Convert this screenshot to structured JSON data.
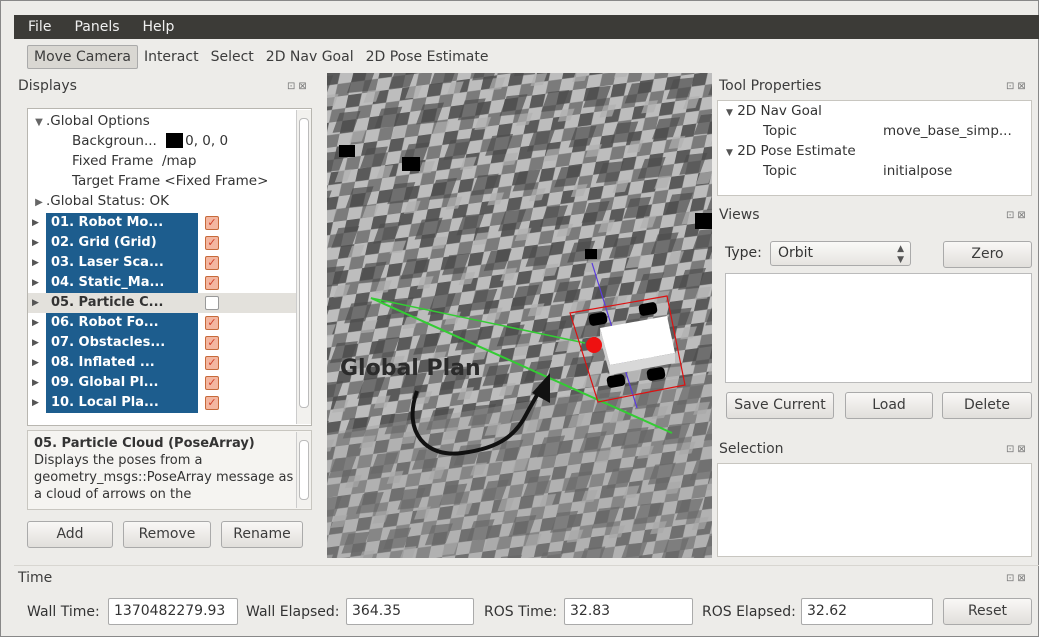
{
  "menu": [
    "File",
    "Panels",
    "Help"
  ],
  "toolbar": [
    "Move Camera",
    "Interact",
    "Select",
    "2D Nav Goal",
    "2D Pose Estimate"
  ],
  "displays": {
    "title": "Displays",
    "global_options": ".Global Options",
    "background_label": "Backgroun...",
    "background_value": "0, 0, 0",
    "fixed_frame_label": "Fixed Frame",
    "fixed_frame_value": "/map",
    "target_frame_label": "Target Frame",
    "target_frame_value": "<Fixed Frame>",
    "global_status": ".Global Status: OK",
    "items": [
      {
        "label": "01. Robot Mo...",
        "checked": true
      },
      {
        "label": "02. Grid (Grid)",
        "checked": true
      },
      {
        "label": "03. Laser Sca...",
        "checked": true
      },
      {
        "label": "04. Static_Ma...",
        "checked": true
      },
      {
        "label": "05. Particle C...",
        "checked": false
      },
      {
        "label": "06. Robot Fo...",
        "checked": true
      },
      {
        "label": "07. Obstacles...",
        "checked": true
      },
      {
        "label": "08. Inflated ...",
        "checked": true
      },
      {
        "label": "09. Global Pl...",
        "checked": true
      },
      {
        "label": "10. Local Pla...",
        "checked": true
      }
    ],
    "description_title": "05. Particle Cloud (PoseArray)",
    "description_text": "Displays the poses from a geometry_msgs::PoseArray message as a cloud of arrows on the",
    "buttons": {
      "add": "Add",
      "remove": "Remove",
      "rename": "Rename"
    }
  },
  "view3d": {
    "annotation": "Global Plan"
  },
  "tool_properties": {
    "title": "Tool Properties",
    "nav_goal": "2D Nav Goal",
    "nav_topic_label": "Topic",
    "nav_topic_value": "move_base_simp...",
    "pose_estimate": "2D Pose Estimate",
    "pose_topic_label": "Topic",
    "pose_topic_value": "initialpose"
  },
  "views": {
    "title": "Views",
    "type_label": "Type:",
    "type_value": "Orbit",
    "zero": "Zero",
    "save_current": "Save Current",
    "load": "Load",
    "delete": "Delete"
  },
  "selection": {
    "title": "Selection"
  },
  "time": {
    "title": "Time",
    "wall_time_label": "Wall Time:",
    "wall_time": "1370482279.93",
    "wall_elapsed_label": "Wall Elapsed:",
    "wall_elapsed": "364.35",
    "ros_time_label": "ROS Time:",
    "ros_time": "32.83",
    "ros_elapsed_label": "ROS Elapsed:",
    "ros_elapsed": "32.62",
    "reset": "Reset"
  },
  "colors": {
    "menubar": "#3c3b37",
    "selection_blue": "#1d5d8e",
    "plan_green": "#33cc33",
    "robot_red": "#ee1111"
  }
}
